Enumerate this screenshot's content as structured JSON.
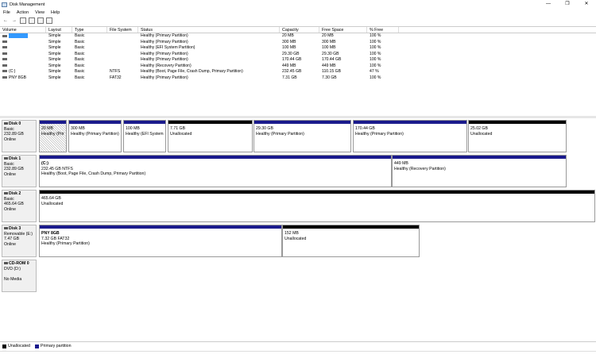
{
  "window": {
    "title": "Disk Management",
    "controls": [
      "—",
      "❐",
      "✕"
    ]
  },
  "menu": [
    "File",
    "Action",
    "View",
    "Help"
  ],
  "toolbar": [
    "back-arrow",
    "forward-arrow",
    "properties",
    "help",
    "refresh",
    "console"
  ],
  "table": {
    "headers": [
      "Volume",
      "Layout",
      "Type",
      "File System",
      "Status",
      "Capacity",
      "Free Space",
      "% Free"
    ],
    "rows": [
      [
        "",
        "Simple",
        "Basic",
        "",
        "Healthy (Primary Partition)",
        "20 MB",
        "20 MB",
        "100 %"
      ],
      [
        "",
        "Simple",
        "Basic",
        "",
        "Healthy (Primary Partition)",
        "300 MB",
        "300 MB",
        "100 %"
      ],
      [
        "",
        "Simple",
        "Basic",
        "",
        "Healthy (EFI System Partition)",
        "100 MB",
        "100 MB",
        "100 %"
      ],
      [
        "",
        "Simple",
        "Basic",
        "",
        "Healthy (Primary Partition)",
        "29.30 GB",
        "29.30 GB",
        "100 %"
      ],
      [
        "",
        "Simple",
        "Basic",
        "",
        "Healthy (Primary Partition)",
        "170.44 GB",
        "170.44 GB",
        "100 %"
      ],
      [
        "",
        "Simple",
        "Basic",
        "",
        "Healthy (Recovery Partition)",
        "449 MB",
        "449 MB",
        "100 %"
      ],
      [
        "(C:)",
        "Simple",
        "Basic",
        "NTFS",
        "Healthy (Boot, Page File, Crash Dump, Primary Partition)",
        "232.45 GB",
        "110.15 GB",
        "47 %"
      ],
      [
        "PNY 8GB",
        "Simple",
        "Basic",
        "FAT32",
        "Healthy (Primary Partition)",
        "7.31 GB",
        "7.30 GB",
        "100 %"
      ]
    ]
  },
  "disks": [
    {
      "name": "Disk 0",
      "lines": [
        "Basic",
        "232.89 GB",
        "Online"
      ],
      "partitions": [
        {
          "kind": "primary",
          "hatched": true,
          "lines": [
            "20 MB",
            "Healthy (Prir"
          ]
        },
        {
          "kind": "primary",
          "lines": [
            "300 MB",
            "Healthy (Primary Partition)"
          ]
        },
        {
          "kind": "primary",
          "lines": [
            "100 MB",
            "Healthy (EFI System"
          ]
        },
        {
          "kind": "unalloc",
          "lines": [
            "7.71 GB",
            "Unallocated"
          ]
        },
        {
          "kind": "primary",
          "lines": [
            "29.30 GB",
            "Healthy (Primary Partition)"
          ]
        },
        {
          "kind": "primary",
          "lines": [
            "170.44 GB",
            "Healthy (Primary Partition)"
          ]
        },
        {
          "kind": "unalloc",
          "lines": [
            "25.02 GB",
            "Unallocated"
          ]
        }
      ]
    },
    {
      "name": "Disk 1",
      "lines": [
        "Basic",
        "232.89 GB",
        "Online"
      ],
      "partitions": [
        {
          "kind": "primary",
          "lines": [
            "(C:)",
            "232.45 GB NTFS",
            "Healthy (Boot, Page File, Crash Dump, Primary Partition)"
          ],
          "bold_first": true
        },
        {
          "kind": "primary",
          "lines": [
            "449 MB",
            "Healthy (Recovery Partition)"
          ]
        }
      ]
    },
    {
      "name": "Disk 2",
      "lines": [
        "Basic",
        "465.64 GB",
        "Online"
      ],
      "partitions": [
        {
          "kind": "unalloc",
          "lines": [
            "465.64 GB",
            "Unallocated"
          ]
        }
      ]
    },
    {
      "name": "Disk 3",
      "lines": [
        "Removable (E:)",
        "7.47 GB",
        "Online"
      ],
      "partitions": [
        {
          "kind": "primary",
          "lines": [
            "PNY 8GB",
            "7.32 GB FAT32",
            "Healthy (Primary Partition)"
          ],
          "bold_first": true
        },
        {
          "kind": "unalloc",
          "lines": [
            "152 MB",
            "Unallocated"
          ]
        }
      ]
    },
    {
      "name": "CD-ROM 0",
      "lines": [
        "DVD (D:)",
        "",
        "No Media"
      ],
      "partitions": []
    }
  ],
  "legend": [
    {
      "label": "Unallocated",
      "color": "#000000"
    },
    {
      "label": "Primary partition",
      "color": "#1a1a8c"
    }
  ]
}
